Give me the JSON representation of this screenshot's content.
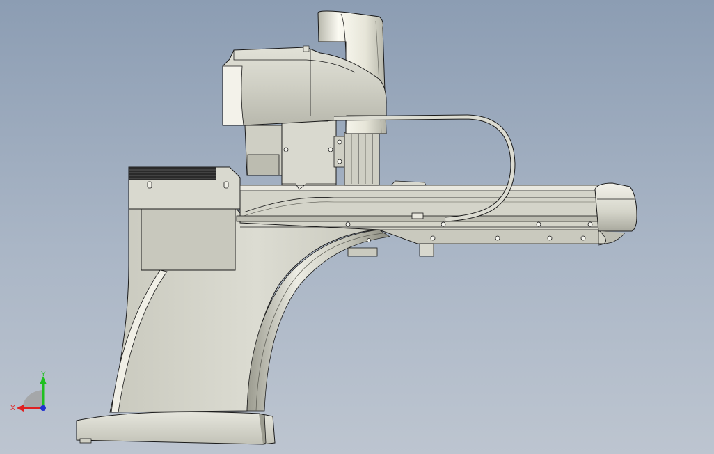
{
  "viewport": {
    "background_top": "#8c9db3",
    "background_bottom": "#bdc5d0"
  },
  "model": {
    "body_color": "#d8d8ce",
    "edge_color": "#1a1a1a",
    "highlight_color": "#f3f2ea",
    "shade_color": "#8f8f84"
  },
  "triad": {
    "x_label": "X",
    "y_label": "Y",
    "x_color": "#e02020",
    "y_color": "#20c020",
    "z_color": "#2030d0"
  }
}
